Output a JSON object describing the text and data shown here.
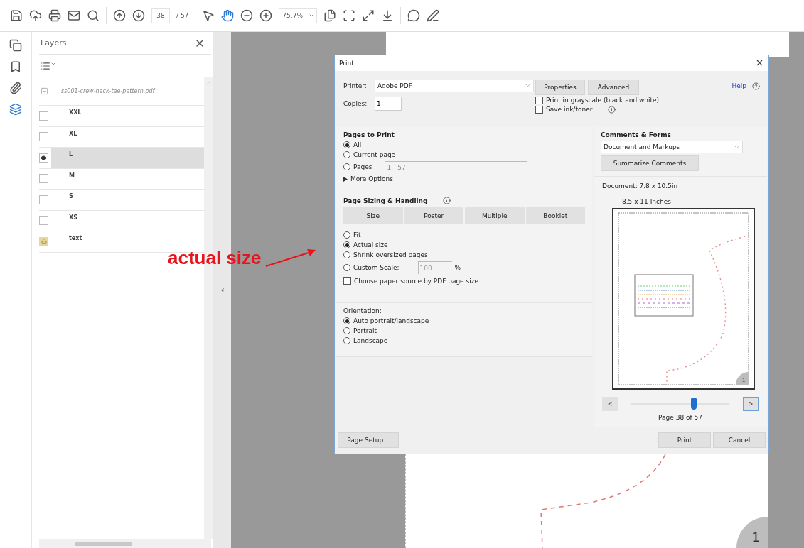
{
  "toolbar": {
    "page_current": "38",
    "page_total": "/ 57",
    "zoom": "75.7%",
    "tools": [
      {
        "kind": "select",
        "selected": false
      },
      {
        "kind": "hand",
        "selected": true
      }
    ]
  },
  "side_rail": [
    {
      "kind": "pages",
      "selected": false
    },
    {
      "kind": "bookmarks",
      "selected": false
    },
    {
      "kind": "attachments",
      "selected": false
    },
    {
      "kind": "layers",
      "selected": true
    }
  ],
  "layers_panel": {
    "title": "Layers",
    "document": "ss001-crew-neck-tee-pattern.pdf",
    "layers": [
      {
        "name": "XXL",
        "kind": "toggle",
        "visible": false,
        "selected": false
      },
      {
        "name": "XL",
        "kind": "toggle",
        "visible": false,
        "selected": false
      },
      {
        "name": "L",
        "kind": "toggle",
        "visible": true,
        "selected": true
      },
      {
        "name": "M",
        "kind": "toggle",
        "visible": false,
        "selected": false
      },
      {
        "name": "S",
        "kind": "toggle",
        "visible": false,
        "selected": false
      },
      {
        "name": "XS",
        "kind": "toggle",
        "visible": false,
        "selected": false
      },
      {
        "name": "text",
        "kind": "locked",
        "visible": true,
        "selected": false
      }
    ]
  },
  "document": {
    "page_badge": "1"
  },
  "annotation": {
    "text": "actual size"
  },
  "print_dialog": {
    "title": "Print",
    "printer_label": "Printer:",
    "printer": "Adobe PDF",
    "buttons": [
      "Properties",
      "Advanced"
    ],
    "help": "Help",
    "copies_label": "Copies:",
    "copies": "1",
    "options": [
      {
        "label": "Print in grayscale (black and white)",
        "checked": false
      },
      {
        "label": "Save ink/toner",
        "checked": false
      }
    ],
    "pages_to_print": {
      "heading": "Pages to Print",
      "options": [
        {
          "label": "All",
          "selected": true
        },
        {
          "label": "Current page",
          "selected": false
        },
        {
          "label": "Pages",
          "selected": false
        }
      ],
      "range": "1 - 57",
      "more": "More Options"
    },
    "page_sizing": {
      "heading": "Page Sizing & Handling",
      "tabs": [
        "Size",
        "Poster",
        "Multiple",
        "Booklet"
      ],
      "options": [
        {
          "label": "Fit",
          "selected": false
        },
        {
          "label": "Actual size",
          "selected": true
        },
        {
          "label": "Shrink oversized pages",
          "selected": false
        },
        {
          "label": "Custom Scale:",
          "selected": false,
          "field": "100",
          "unit": "%"
        }
      ],
      "paper_source": {
        "label": "Choose paper source by PDF page size",
        "checked": false
      }
    },
    "orientation": {
      "label": "Orientation:",
      "options": [
        {
          "label": "Auto portrait/landscape",
          "selected": true
        },
        {
          "label": "Portrait",
          "selected": false
        },
        {
          "label": "Landscape",
          "selected": false
        }
      ]
    },
    "comments": {
      "heading": "Comments & Forms",
      "value": "Document and Markups",
      "button": "Summarize Comments"
    },
    "document_size": "Document: 7.8 x 10.5in",
    "paper_size": "8.5 x 11 Inches",
    "preview_badge": "1",
    "prev": "<",
    "next": ">",
    "slider": {
      "level": 0.64
    },
    "page_label": "Page 38 of 57",
    "footer": {
      "setup": "Page Setup...",
      "print": "Print",
      "cancel": "Cancel"
    }
  }
}
